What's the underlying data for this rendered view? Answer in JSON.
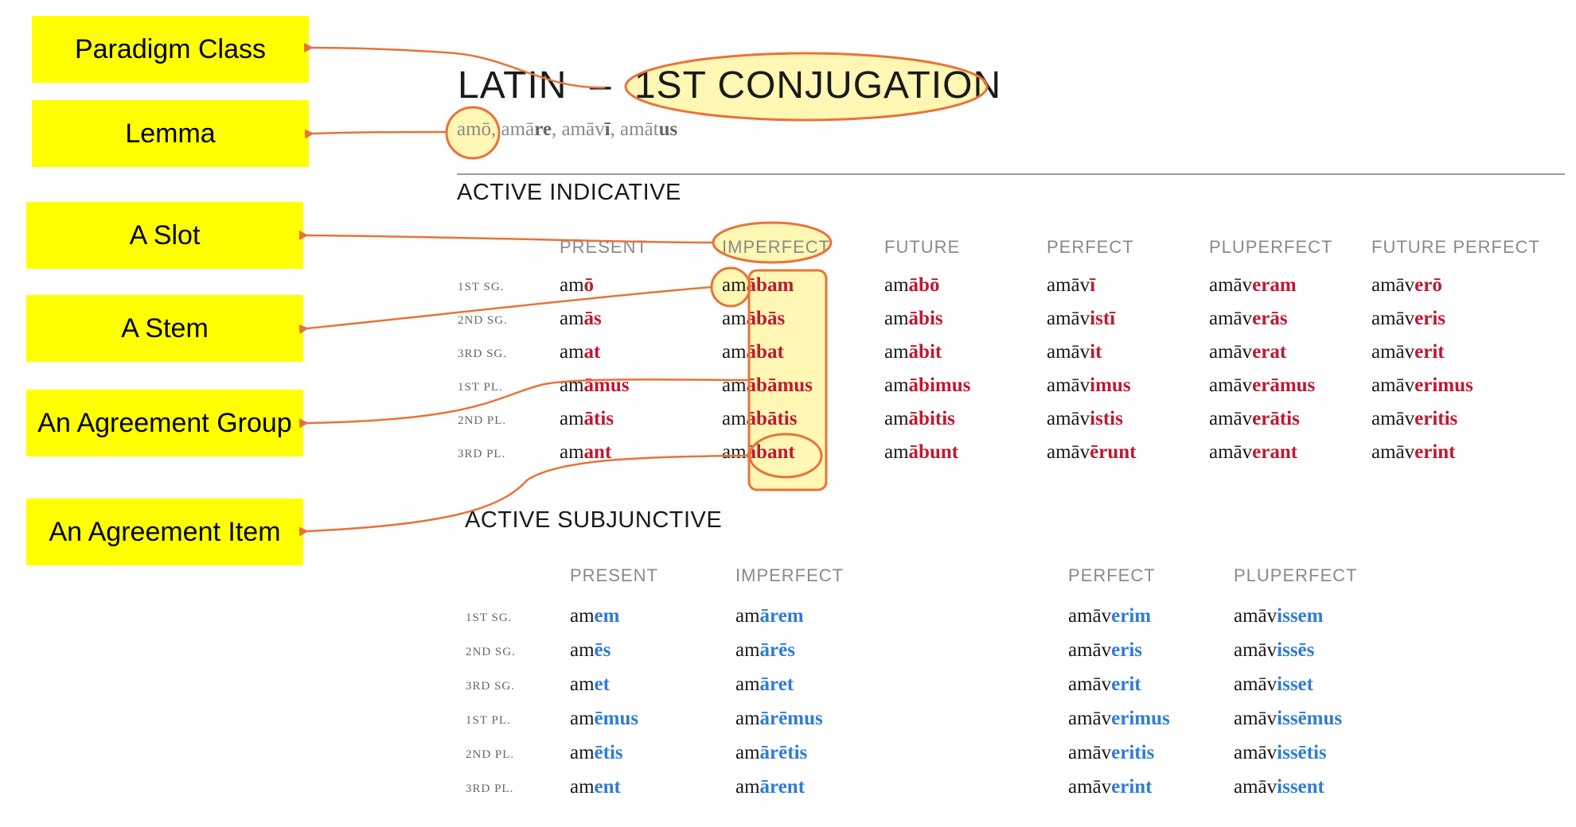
{
  "labels": {
    "paradigm_class": "Paradigm Class",
    "lemma": "Lemma",
    "slot": "A Slot",
    "stem": "A Stem",
    "agreement_group": "An Agreement Group",
    "agreement_item": "An Agreement Item"
  },
  "title": {
    "lang": "LATIN",
    "dash": "–",
    "conjugation": "1ST CONJUGATION"
  },
  "principal_parts": {
    "p1_stem": "amō",
    "p2_stem": "amā",
    "p2_end": "re",
    "p3_stem": "amāv",
    "p3_end": "ī",
    "p4_stem": "amāt",
    "p4_end": "us",
    "sep": ","
  },
  "indicative": {
    "title": "ACTIVE INDICATIVE",
    "columns": [
      "PRESENT",
      "IMPERFECT",
      "FUTURE",
      "PERFECT",
      "PLUPERFECT",
      "FUTURE PERFECT"
    ],
    "rows": [
      "1ST SG.",
      "2ND SG.",
      "3RD SG.",
      "1ST PL.",
      "2ND PL.",
      "3RD PL."
    ],
    "cells": [
      [
        [
          "am",
          "ō"
        ],
        [
          "am",
          "ābam"
        ],
        [
          "am",
          "ābō"
        ],
        [
          "amāv",
          "ī"
        ],
        [
          "amāv",
          "eram"
        ],
        [
          "amāv",
          "erō"
        ]
      ],
      [
        [
          "am",
          "ās"
        ],
        [
          "am",
          "ābās"
        ],
        [
          "am",
          "ābis"
        ],
        [
          "amāv",
          "istī"
        ],
        [
          "amāv",
          "erās"
        ],
        [
          "amāv",
          "eris"
        ]
      ],
      [
        [
          "am",
          "at"
        ],
        [
          "am",
          "ābat"
        ],
        [
          "am",
          "ābit"
        ],
        [
          "amāv",
          "it"
        ],
        [
          "amāv",
          "erat"
        ],
        [
          "amāv",
          "erit"
        ]
      ],
      [
        [
          "am",
          "āmus"
        ],
        [
          "am",
          "ābāmus"
        ],
        [
          "am",
          "ābimus"
        ],
        [
          "amāv",
          "imus"
        ],
        [
          "amāv",
          "erāmus"
        ],
        [
          "amāv",
          "erimus"
        ]
      ],
      [
        [
          "am",
          "ātis"
        ],
        [
          "am",
          "ābātis"
        ],
        [
          "am",
          "ābitis"
        ],
        [
          "amāv",
          "istis"
        ],
        [
          "amāv",
          "erātis"
        ],
        [
          "amāv",
          "eritis"
        ]
      ],
      [
        [
          "am",
          "ant"
        ],
        [
          "am",
          "ābant"
        ],
        [
          "am",
          "ābunt"
        ],
        [
          "amāv",
          "ērunt"
        ],
        [
          "amāv",
          "erant"
        ],
        [
          "amāv",
          "erint"
        ]
      ]
    ]
  },
  "subjunctive": {
    "title": "ACTIVE SUBJUNCTIVE",
    "columns": [
      "PRESENT",
      "IMPERFECT",
      "PERFECT",
      "PLUPERFECT"
    ],
    "rows": [
      "1ST SG.",
      "2ND SG.",
      "3RD SG.",
      "1ST PL.",
      "2ND PL.",
      "3RD PL."
    ],
    "cells": [
      [
        [
          "am",
          "em"
        ],
        [
          "am",
          "ārem"
        ],
        [
          "amāv",
          "erim"
        ],
        [
          "amāv",
          "issem"
        ]
      ],
      [
        [
          "am",
          "ēs"
        ],
        [
          "am",
          "ārēs"
        ],
        [
          "amāv",
          "eris"
        ],
        [
          "amāv",
          "issēs"
        ]
      ],
      [
        [
          "am",
          "et"
        ],
        [
          "am",
          "āret"
        ],
        [
          "amāv",
          "erit"
        ],
        [
          "amāv",
          "isset"
        ]
      ],
      [
        [
          "am",
          "ēmus"
        ],
        [
          "am",
          "ārēmus"
        ],
        [
          "amāv",
          "erimus"
        ],
        [
          "amāv",
          "issēmus"
        ]
      ],
      [
        [
          "am",
          "ētis"
        ],
        [
          "am",
          "ārētis"
        ],
        [
          "amāv",
          "eritis"
        ],
        [
          "amāv",
          "issētis"
        ]
      ],
      [
        [
          "am",
          "ent"
        ],
        [
          "am",
          "ārent"
        ],
        [
          "amāv",
          "erint"
        ],
        [
          "amāv",
          "issent"
        ]
      ]
    ]
  },
  "colors": {
    "label_bg": "#ffff00",
    "arrow": "#e8733a",
    "highlight": "#fff7b3",
    "ending_indicative": "#c0182f",
    "ending_subjunctive": "#2f7cd6"
  }
}
